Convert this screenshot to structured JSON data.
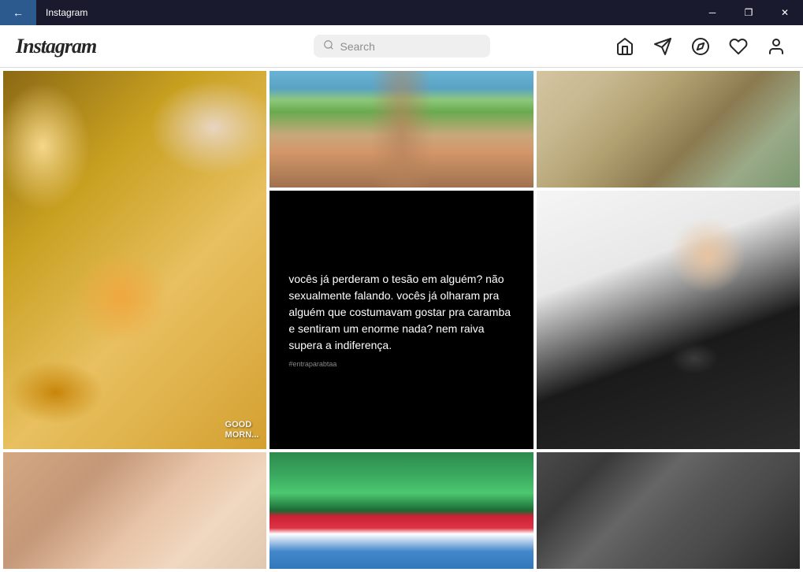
{
  "titlebar": {
    "back_label": "←",
    "title": "Instagram",
    "minimize_label": "─",
    "maximize_label": "❐",
    "close_label": "✕"
  },
  "header": {
    "logo": "Instagram",
    "search_placeholder": "Search"
  },
  "nav": {
    "home_icon": "home",
    "send_icon": "send",
    "explore_icon": "compass",
    "heart_icon": "heart",
    "profile_icon": "user"
  },
  "posts": [
    {
      "id": "post-1",
      "type": "food",
      "overlay_text": "GOOD\nMORN..."
    },
    {
      "id": "post-2",
      "type": "bikini"
    },
    {
      "id": "post-3",
      "type": "reptile"
    },
    {
      "id": "post-4",
      "type": "text",
      "text_content": "vocês já perderam o tesão em alguém? não sexualmente falando. vocês já olharam pra alguém que costumavam gostar pra caramba e sentiram um enorme nada? nem raiva supera a indiferença.",
      "tag": "#entraparabtaa"
    },
    {
      "id": "post-5",
      "type": "soccer_player"
    },
    {
      "id": "post-6",
      "type": "woman_glasses"
    },
    {
      "id": "post-7",
      "type": "woman_red_hat"
    },
    {
      "id": "post-8",
      "type": "couple_bw"
    }
  ]
}
